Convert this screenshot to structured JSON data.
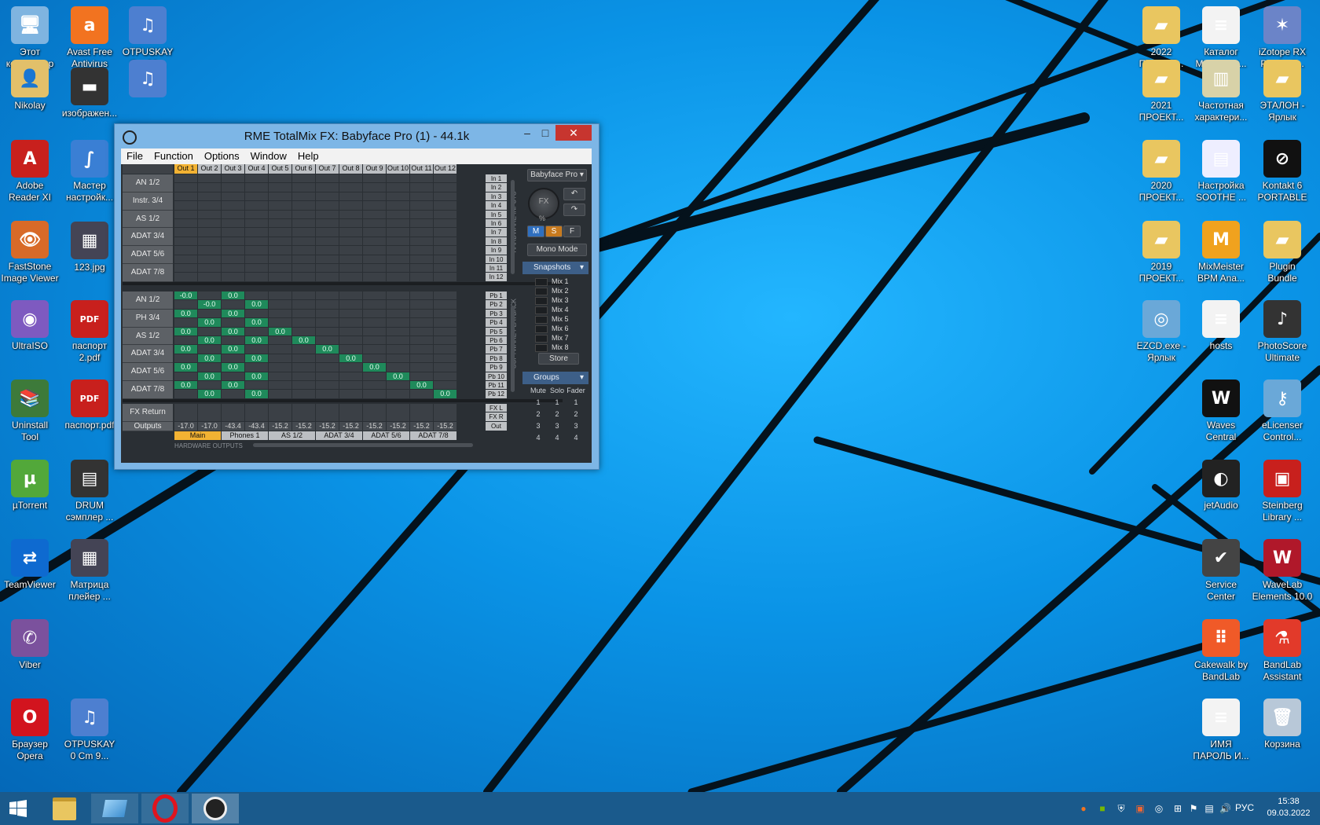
{
  "colors": {
    "desk_top": "#23b6ff",
    "desk_bottom": "#0468b8",
    "taskbar": "#1a5a8c",
    "cell_active": "#1f8a5b",
    "out_selected": "#f2b233",
    "mixer_bg": "#2a2f34"
  },
  "desktop_icons": [
    {
      "label": "Этот\nкомпьютер",
      "icon": "computer-icon",
      "color": "#7fb4e0",
      "glyph": "🖥"
    },
    {
      "label": "Nikolay",
      "icon": "user-folder-icon",
      "color": "#e2c06a",
      "glyph": "👤"
    },
    {
      "label": "Adobe\nReader XI",
      "icon": "adobe-reader-icon",
      "color": "#c8201d",
      "glyph": "A"
    },
    {
      "label": "FastStone\nImage Viewer",
      "icon": "faststone-icon",
      "color": "#d86a28",
      "glyph": "👁"
    },
    {
      "label": "UltraISO",
      "icon": "ultraiso-icon",
      "color": "#7e5ac0",
      "glyph": "◉"
    },
    {
      "label": "Uninstall\nTool",
      "icon": "uninstall-tool-icon",
      "color": "#3d7a3a",
      "glyph": "📚"
    },
    {
      "label": "µTorrent",
      "icon": "utorrent-icon",
      "color": "#52a83a",
      "glyph": "µ"
    },
    {
      "label": "TeamViewer",
      "icon": "teamviewer-icon",
      "color": "#0e6ad0",
      "glyph": "⇄"
    },
    {
      "label": "Viber",
      "icon": "viber-icon",
      "color": "#7b519d",
      "glyph": "✆"
    },
    {
      "label": "Браузер\nOpera",
      "icon": "opera-icon",
      "color": "#d2141e",
      "glyph": "O"
    },
    {
      "label": "Avast Free\nAntivirus",
      "icon": "avast-icon",
      "color": "#f27320",
      "glyph": "a"
    },
    {
      "label": "изображен...",
      "icon": "image-file-icon",
      "color": "#333",
      "glyph": "▬"
    },
    {
      "label": "Мастер\nнастройк...",
      "icon": "wizard-icon",
      "color": "#3a7fd4",
      "glyph": "∫"
    },
    {
      "label": "123.jpg",
      "icon": "jpg-file-icon",
      "color": "#445",
      "glyph": "▦"
    },
    {
      "label": "паспорт\n2.pdf",
      "icon": "pdf-file-icon",
      "color": "#c8201d",
      "glyph": "PDF"
    },
    {
      "label": "паспорт.pdf",
      "icon": "pdf-file-icon",
      "color": "#c8201d",
      "glyph": "PDF"
    },
    {
      "label": "DRUM\nсэмплер ...",
      "icon": "drum-sampler-icon",
      "color": "#333",
      "glyph": "▤"
    },
    {
      "label": "Матрица\nплейер ...",
      "icon": "matrix-player-icon",
      "color": "#445",
      "glyph": "▦"
    },
    {
      "label": "OTPUSKAY\n0 Cm 9...",
      "icon": "audio-file-icon",
      "color": "#4d7fd0",
      "glyph": "♫"
    },
    {
      "label": "OTPUSKAY\nCm 92...",
      "icon": "audio-file-icon",
      "color": "#4d7fd0",
      "glyph": "♫"
    },
    {
      "label": "",
      "icon": "audio-file-icon",
      "color": "#4d7fd0",
      "glyph": "♫"
    },
    {
      "label": "2022\nПРОЕКТ...",
      "icon": "folder-icon",
      "color": "#e9c660",
      "glyph": "▰"
    },
    {
      "label": "2021\nПРОЕКТ...",
      "icon": "folder-icon",
      "color": "#e9c660",
      "glyph": "▰"
    },
    {
      "label": "2020\nПРОЕКТ...",
      "icon": "folder-icon",
      "color": "#e9c660",
      "glyph": "▰"
    },
    {
      "label": "2019\nПРОЕКТ...",
      "icon": "folder-icon",
      "color": "#e9c660",
      "glyph": "▰"
    },
    {
      "label": "EZCD.exe -\nЯрлык",
      "icon": "ezcd-icon",
      "color": "#6aa8d8",
      "glyph": "◎"
    },
    {
      "label": "Каталог\nМинусов.t...",
      "icon": "text-file-icon",
      "color": "#f3f3f3",
      "glyph": "≡"
    },
    {
      "label": "Частотная\nхарактери...",
      "icon": "eq-image-icon",
      "color": "#d8d2a8",
      "glyph": "▥"
    },
    {
      "label": "Настройка\nSOOTHE ...",
      "icon": "soothe-icon",
      "color": "#eef",
      "glyph": "▤"
    },
    {
      "label": "MixMeister\nBPM Ana...",
      "icon": "mixmeister-icon",
      "color": "#f0a21e",
      "glyph": "M"
    },
    {
      "label": "hosts",
      "icon": "text-file-icon",
      "color": "#f3f3f3",
      "glyph": "≡"
    },
    {
      "label": "Waves\nCentral",
      "icon": "waves-icon",
      "color": "#111",
      "glyph": "W"
    },
    {
      "label": "jetAudio",
      "icon": "jetaudio-icon",
      "color": "#222",
      "glyph": "◐"
    },
    {
      "label": "Service\nCenter",
      "icon": "service-center-icon",
      "color": "#444",
      "glyph": "✔"
    },
    {
      "label": "Cakewalk by\nBandLab",
      "icon": "cakewalk-icon",
      "color": "#f05a28",
      "glyph": "⠿"
    },
    {
      "label": "ИМЯ\nПАРОЛЬ И...",
      "icon": "text-file-icon",
      "color": "#f3f3f3",
      "glyph": "≡"
    },
    {
      "label": "iZotope RX\nPro Audi...",
      "icon": "izotope-icon",
      "color": "#6b84c8",
      "glyph": "✶"
    },
    {
      "label": "ЭТАЛОН -\nЯрлык",
      "icon": "folder-shortcut-icon",
      "color": "#e9c660",
      "glyph": "▰"
    },
    {
      "label": "Kontakt 6\nPORTABLE",
      "icon": "kontakt-icon",
      "color": "#111",
      "glyph": "⊘"
    },
    {
      "label": "Plugin\nBundle",
      "icon": "folder-icon",
      "color": "#e9c660",
      "glyph": "▰"
    },
    {
      "label": "PhotoScore\nUltimate",
      "icon": "photoscore-icon",
      "color": "#333",
      "glyph": "♪"
    },
    {
      "label": "eLicenser\nControl...",
      "icon": "elicenser-icon",
      "color": "#6aa8d8",
      "glyph": "⚷"
    },
    {
      "label": "Steinberg\nLibrary ...",
      "icon": "steinberg-library-icon",
      "color": "#c8201d",
      "glyph": "▣"
    },
    {
      "label": "WaveLab\nElements 10.0",
      "icon": "wavelab-icon",
      "color": "#b0182a",
      "glyph": "W"
    },
    {
      "label": "BandLab\nAssistant",
      "icon": "bandlab-icon",
      "color": "#e23a2a",
      "glyph": "⚗"
    },
    {
      "label": "Корзина",
      "icon": "recycle-bin-icon",
      "color": "#b8c8d8",
      "glyph": "🗑"
    }
  ],
  "window": {
    "title": "RME TotalMix FX: Babyface Pro (1) - 44.1k",
    "minimize": "–",
    "maximize": "□",
    "close": "✕",
    "menu": [
      "File",
      "Function",
      "Options",
      "Window",
      "Help"
    ]
  },
  "mixer": {
    "out_headers": [
      "Out 1",
      "Out 2",
      "Out 3",
      "Out 4",
      "Out 5",
      "Out 6",
      "Out 7",
      "Out 8",
      "Out 9",
      "Out 10",
      "Out 11",
      "Out 12"
    ],
    "selected_out": 0,
    "input_rows": [
      "AN 1/2",
      "Instr. 3/4",
      "AS 1/2",
      "ADAT 3/4",
      "ADAT 5/6",
      "ADAT 7/8"
    ],
    "playback_rows": [
      "AN 1/2",
      "PH 3/4",
      "AS 1/2",
      "ADAT 3/4",
      "ADAT 5/6",
      "ADAT 7/8"
    ],
    "in_labels": [
      "In 1",
      "In 2",
      "In 3",
      "In 4",
      "In 5",
      "In 6",
      "In 7",
      "In 8",
      "In 9",
      "In 10",
      "In 11",
      "In 12"
    ],
    "pb_labels": [
      "Pb 1",
      "Pb 2",
      "Pb 3",
      "Pb 4",
      "Pb 5",
      "Pb 6",
      "Pb 7",
      "Pb 8",
      "Pb 9",
      "Pb 10",
      "Pb 11",
      "Pb 12"
    ],
    "playback_cells": [
      {
        "row": 0,
        "col": 0,
        "v": "-0.0"
      },
      {
        "row": 0,
        "col": 2,
        "v": "0.0"
      },
      {
        "row": 1,
        "col": 1,
        "v": "-0.0"
      },
      {
        "row": 1,
        "col": 3,
        "v": "0.0"
      },
      {
        "row": 2,
        "col": 0,
        "v": "0.0"
      },
      {
        "row": 2,
        "col": 2,
        "v": "0.0"
      },
      {
        "row": 3,
        "col": 1,
        "v": "0.0"
      },
      {
        "row": 3,
        "col": 3,
        "v": "0.0"
      },
      {
        "row": 4,
        "col": 0,
        "v": "0.0"
      },
      {
        "row": 4,
        "col": 2,
        "v": "0.0"
      },
      {
        "row": 4,
        "col": 4,
        "v": "0.0"
      },
      {
        "row": 5,
        "col": 1,
        "v": "0.0"
      },
      {
        "row": 5,
        "col": 3,
        "v": "0.0"
      },
      {
        "row": 5,
        "col": 5,
        "v": "0.0"
      },
      {
        "row": 6,
        "col": 0,
        "v": "0.0"
      },
      {
        "row": 6,
        "col": 2,
        "v": "0.0"
      },
      {
        "row": 6,
        "col": 6,
        "v": "0.0"
      },
      {
        "row": 7,
        "col": 1,
        "v": "0.0"
      },
      {
        "row": 7,
        "col": 3,
        "v": "0.0"
      },
      {
        "row": 7,
        "col": 7,
        "v": "0.0"
      },
      {
        "row": 8,
        "col": 0,
        "v": "0.0"
      },
      {
        "row": 8,
        "col": 2,
        "v": "0.0"
      },
      {
        "row": 8,
        "col": 8,
        "v": "0.0"
      },
      {
        "row": 9,
        "col": 1,
        "v": "0.0"
      },
      {
        "row": 9,
        "col": 3,
        "v": "0.0"
      },
      {
        "row": 9,
        "col": 9,
        "v": "0.0"
      },
      {
        "row": 10,
        "col": 0,
        "v": "0.0"
      },
      {
        "row": 10,
        "col": 2,
        "v": "0.0"
      },
      {
        "row": 10,
        "col": 10,
        "v": "0.0"
      },
      {
        "row": 11,
        "col": 1,
        "v": "0.0"
      },
      {
        "row": 11,
        "col": 3,
        "v": "0.0"
      },
      {
        "row": 11,
        "col": 11,
        "v": "0.0"
      }
    ],
    "fx_return_label": "FX Return",
    "outputs_label": "Outputs",
    "output_values": [
      "-17.0",
      "-17.0",
      "-43.4",
      "-43.4",
      "-15.2",
      "-15.2",
      "-15.2",
      "-15.2",
      "-15.2",
      "-15.2",
      "-15.2",
      "-15.2"
    ],
    "fx_labels": [
      "FX L",
      "FX R"
    ],
    "out_label": "Out",
    "output_pairs": [
      "Main",
      "Phones 1",
      "AS 1/2",
      "ADAT 3/4",
      "ADAT 5/6",
      "ADAT 7/8"
    ],
    "hw_inputs_label": "HARDWARE INPUTS",
    "sw_playback_label": "SOFTWARE PLAYBACK",
    "hw_outputs_label": "HARDWARE OUTPUTS"
  },
  "controls": {
    "device": "Babyface Pro",
    "fx_knob": "FX",
    "fx_unit": "%",
    "m": "M",
    "s": "S",
    "f": "F",
    "mono_mode": "Mono Mode",
    "snapshots": "Snapshots",
    "mixes": [
      "Mix 1",
      "Mix 2",
      "Mix 3",
      "Mix 4",
      "Mix 5",
      "Mix 6",
      "Mix 7",
      "Mix 8"
    ],
    "store": "Store",
    "groups": "Groups",
    "group_headers": [
      "Mute",
      "Solo",
      "Fader"
    ],
    "group_rows": [
      [
        "1",
        "1",
        "1"
      ],
      [
        "2",
        "2",
        "2"
      ],
      [
        "3",
        "3",
        "3"
      ],
      [
        "4",
        "4",
        "4"
      ]
    ]
  },
  "taskbar": {
    "apps": [
      {
        "icon": "start-icon"
      },
      {
        "icon": "file-explorer-icon"
      },
      {
        "icon": "window-app-icon"
      },
      {
        "icon": "opera-icon"
      },
      {
        "icon": "totalmix-icon"
      }
    ],
    "lang": "РУС",
    "time": "15:38",
    "date": "09.03.2022"
  }
}
